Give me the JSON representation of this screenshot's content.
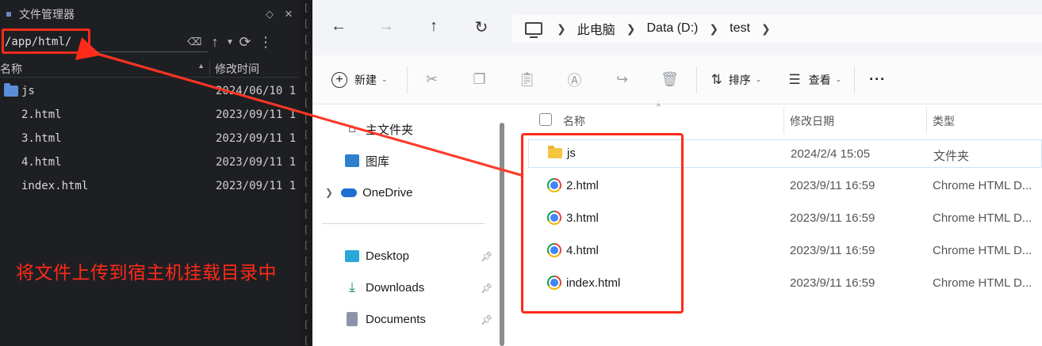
{
  "left_panel": {
    "title": "文件管理器",
    "path_value": "/app/html/",
    "columns": {
      "name": "名称",
      "modified": "修改时间"
    },
    "rows": [
      {
        "name": "js",
        "date": "2024/06/10 1",
        "type": "folder"
      },
      {
        "name": "2.html",
        "date": "2023/09/11 1",
        "type": "file"
      },
      {
        "name": "3.html",
        "date": "2023/09/11 1",
        "type": "file"
      },
      {
        "name": "4.html",
        "date": "2023/09/11 1",
        "type": "file"
      },
      {
        "name": "index.html",
        "date": "2023/09/11 1",
        "type": "file"
      }
    ]
  },
  "annotation": {
    "text": "将文件上传到宿主机挂载目录中",
    "color": "#ff2a1a"
  },
  "explorer": {
    "breadcrumb": [
      "此电脑",
      "Data (D:)",
      "test"
    ],
    "toolbar": {
      "new": "新建",
      "sort": "排序",
      "view": "查看",
      "more": "···"
    },
    "nav": {
      "home": "主文件夹",
      "gallery": "图库",
      "onedrive": "OneDrive",
      "desktop": "Desktop",
      "downloads": "Downloads",
      "documents": "Documents"
    },
    "columns": {
      "name": "名称",
      "date": "修改日期",
      "type": "类型"
    },
    "rows": [
      {
        "name": "js",
        "date": "2024/2/4 15:05",
        "type": "文件夹",
        "kind": "folder"
      },
      {
        "name": "2.html",
        "date": "2023/9/11 16:59",
        "type": "Chrome HTML D...",
        "kind": "chrome"
      },
      {
        "name": "3.html",
        "date": "2023/9/11 16:59",
        "type": "Chrome HTML D...",
        "kind": "chrome"
      },
      {
        "name": "4.html",
        "date": "2023/9/11 16:59",
        "type": "Chrome HTML D...",
        "kind": "chrome"
      },
      {
        "name": "index.html",
        "date": "2023/9/11 16:59",
        "type": "Chrome HTML D...",
        "kind": "chrome"
      }
    ]
  }
}
